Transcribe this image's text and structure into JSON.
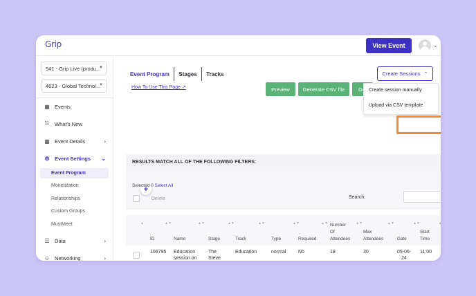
{
  "header": {
    "logo": "Grip",
    "view_event_label": "View Event"
  },
  "sidebar": {
    "selects": [
      "541 - Grip Live (produ...",
      "4623 - Global Technol..."
    ],
    "items": [
      {
        "label": "Events",
        "icon": "calendar-icon"
      },
      {
        "label": "What's New",
        "icon": "bell-icon"
      },
      {
        "label": "Event Details",
        "icon": "calendar-icon"
      },
      {
        "label": "Event Settings",
        "icon": "gear-icon"
      },
      {
        "label": "Data",
        "icon": "list-icon"
      },
      {
        "label": "Networking",
        "icon": "people-icon"
      }
    ],
    "sub_items": [
      "Event Program",
      "Monetization",
      "Relationships",
      "Custom Groups",
      "MustMeet"
    ]
  },
  "main": {
    "tabs": [
      "Event Program",
      "Stages",
      "Tracks"
    ],
    "how_to": "How To Use This Page",
    "create_sessions": "Create Sessions",
    "buttons": {
      "preview": "Preview",
      "generate_csv": "Generate CSV file",
      "gen_partial": "Ge"
    },
    "dropdown": [
      "Create session manually",
      "Upload via CSV template"
    ],
    "filter_title": "RESULTS MATCH ALL OF THE FOLLOWING FILTERS:",
    "selected_prefix": "Selected 0",
    "select_all": "Select All",
    "delete_label": "Delete",
    "search_label": "Search:"
  },
  "table": {
    "headers": [
      [
        "ID"
      ],
      [
        "Name"
      ],
      [
        "Stage"
      ],
      [
        "Track"
      ],
      [
        "Type"
      ],
      [
        "Required"
      ],
      [
        "Number",
        "Of",
        "Attendees"
      ],
      [
        "Max",
        "Attendees"
      ],
      [
        "Date"
      ],
      [
        "Start",
        "Time"
      ]
    ],
    "row": {
      "id": "106795",
      "name": [
        "Education",
        "session on"
      ],
      "stage": [
        "The",
        "Steve"
      ],
      "track": "Education",
      "type": "normal",
      "required": "No",
      "attendees": "18",
      "max": "30",
      "date": [
        "05-06-",
        "24"
      ],
      "start": "11:00"
    }
  },
  "colors": {
    "accent": "#3f2fc2",
    "green": "#5ab277",
    "highlight": "#f08933",
    "background": "#ccc5f7"
  }
}
